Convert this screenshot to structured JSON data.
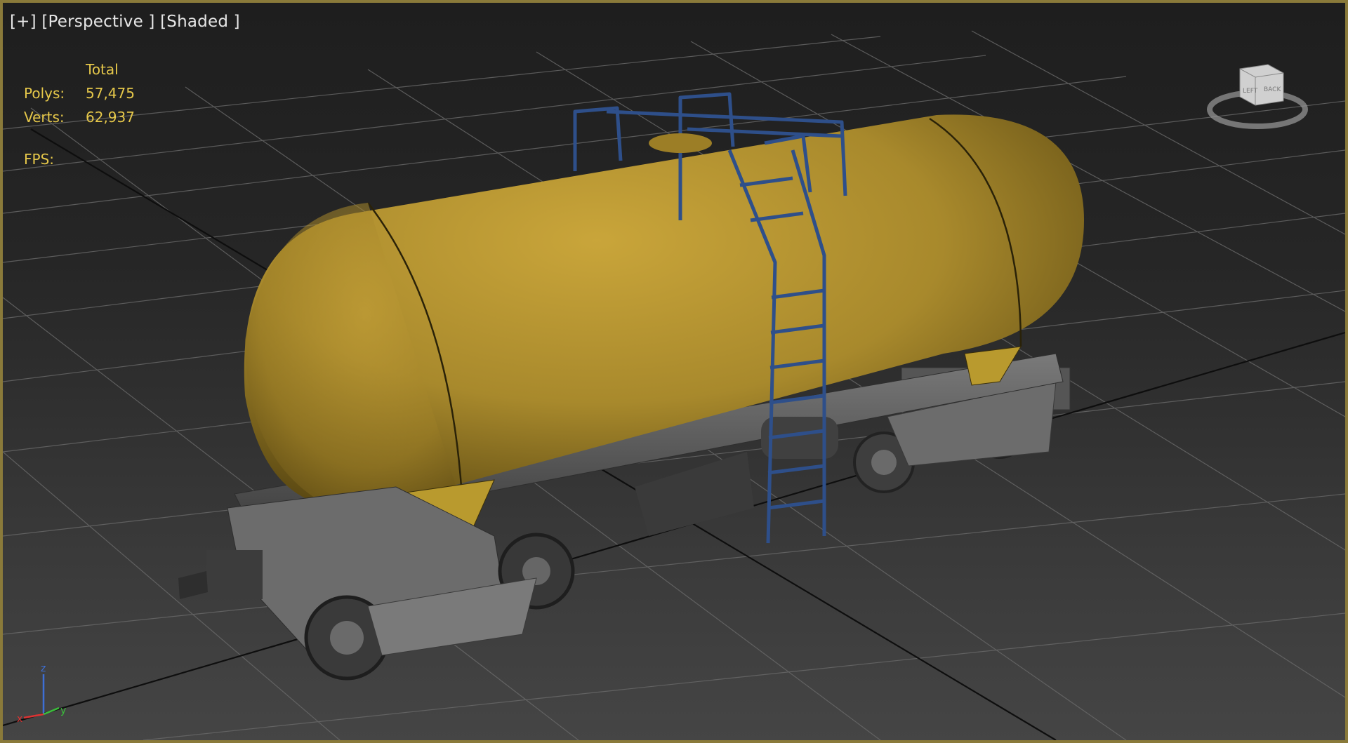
{
  "viewport": {
    "menu": "[+]",
    "view_name": "[Perspective ]",
    "shading": "[Shaded ]"
  },
  "stats": {
    "header": "Total",
    "polys_label": "Polys:",
    "polys_value": "57,475",
    "verts_label": "Verts:",
    "verts_value": "62,937",
    "fps_label": "FPS:"
  },
  "viewcube": {
    "face_left": "LEFT",
    "face_front": "BACK"
  },
  "axis_gizmo": {
    "x": "x",
    "y": "y",
    "z": "z"
  },
  "colors": {
    "tank": "#a8892c",
    "ladder": "#2e4f8a",
    "frame": "#5a5a5a",
    "grid": "#6a6a6a",
    "stats_text": "#e6c84a",
    "border": "#8a7a3a"
  }
}
